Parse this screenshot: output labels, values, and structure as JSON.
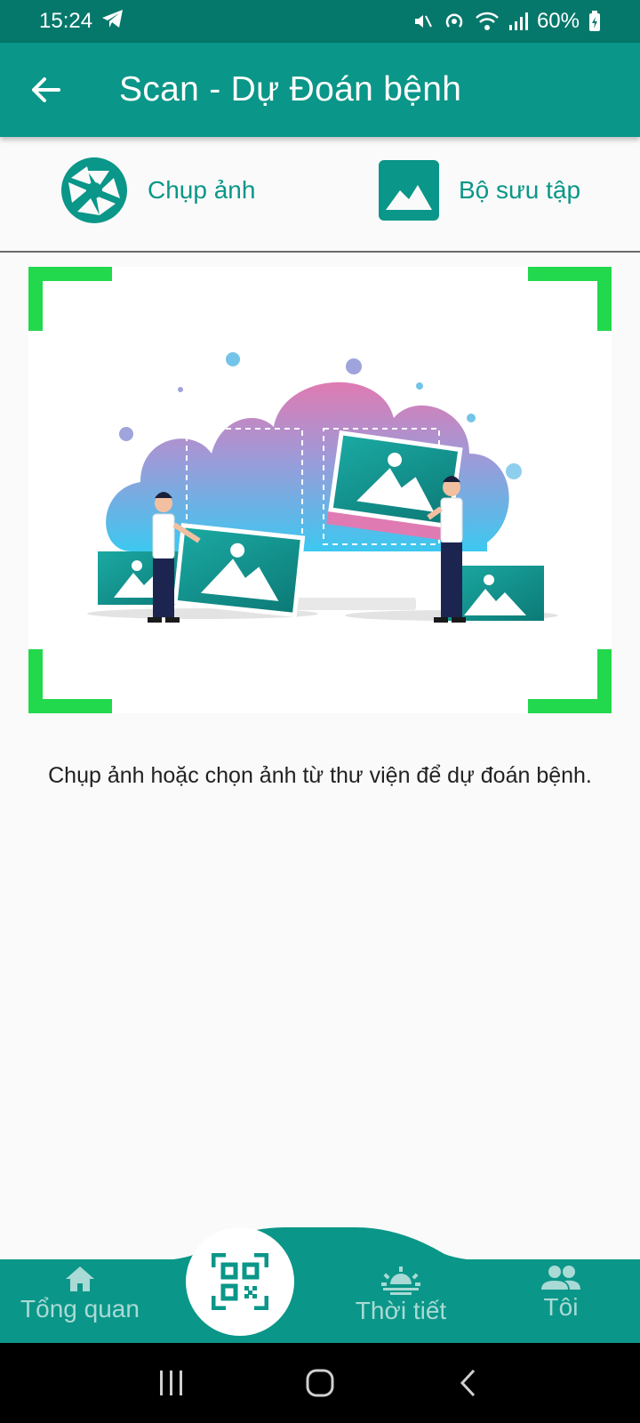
{
  "status_bar": {
    "time": "15:24",
    "battery": "60%",
    "icons": [
      "telegram-icon",
      "mute-icon",
      "hotspot-icon",
      "wifi-icon",
      "signal-icon",
      "battery-icon"
    ]
  },
  "app_bar": {
    "title": "Scan - Dự Đoán bệnh",
    "back_icon": "arrow-left-icon"
  },
  "actions": {
    "camera_label": "Chụp ảnh",
    "gallery_label": "Bộ sưu tập"
  },
  "hint": "Chụp ảnh hoặc chọn ảnh từ thư viện để dự đoán bệnh.",
  "bottom_nav": {
    "items": [
      {
        "label": "Tổng quan",
        "icon": "home-icon"
      },
      {
        "label": "Thời tiết",
        "icon": "weather-sun-icon"
      },
      {
        "label": "Tôi",
        "icon": "people-icon"
      }
    ],
    "center_icon": "qr-scan-icon"
  },
  "colors": {
    "primary": "#0a9688",
    "status_bar": "#06786b",
    "frame_corner": "#22d84d",
    "text": "#222222"
  }
}
